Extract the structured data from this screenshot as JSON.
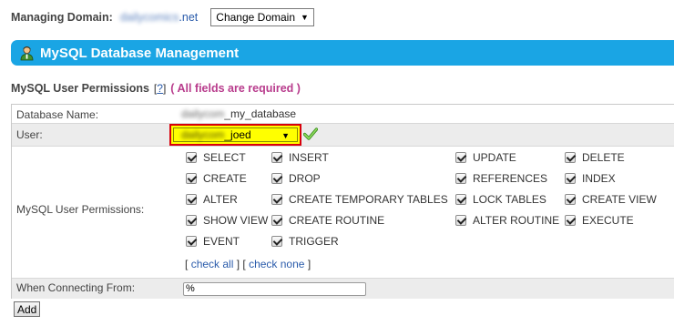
{
  "domain_bar": {
    "label": "Managing Domain:",
    "domain_blurred": "dailycomics",
    "domain_suffix": ".net",
    "change_button": "Change Domain"
  },
  "banner": {
    "title": "MySQL Database Management",
    "icon": "user-icon"
  },
  "section": {
    "title": "MySQL User Permissions",
    "help_open": "[",
    "help_link": "?",
    "help_close": "]",
    "required_note": "( All fields are required )"
  },
  "form": {
    "database_label": "Database Name:",
    "database_prefix_blurred": "dailycom",
    "database_suffix": "_my_database",
    "user_label": "User:",
    "user_prefix_blurred": "dailycom",
    "user_suffix": "_joed",
    "permissions_label": "MySQL User Permissions:",
    "permissions": [
      {
        "label": "SELECT",
        "checked": true
      },
      {
        "label": "INSERT",
        "checked": true
      },
      {
        "label": "UPDATE",
        "checked": true
      },
      {
        "label": "DELETE",
        "checked": true
      },
      {
        "label": "CREATE",
        "checked": true
      },
      {
        "label": "DROP",
        "checked": true
      },
      {
        "label": "REFERENCES",
        "checked": true
      },
      {
        "label": "INDEX",
        "checked": true
      },
      {
        "label": "ALTER",
        "checked": true
      },
      {
        "label": "CREATE TEMPORARY TABLES",
        "checked": true
      },
      {
        "label": "LOCK TABLES",
        "checked": true
      },
      {
        "label": "CREATE VIEW",
        "checked": true
      },
      {
        "label": "SHOW VIEW",
        "checked": true
      },
      {
        "label": "CREATE ROUTINE",
        "checked": true
      },
      {
        "label": "ALTER ROUTINE",
        "checked": true
      },
      {
        "label": "EXECUTE",
        "checked": true
      },
      {
        "label": "EVENT",
        "checked": true
      },
      {
        "label": "TRIGGER",
        "checked": true
      }
    ],
    "check_links": {
      "open": "[",
      "check_all": "check all",
      "sep": "] [",
      "check_none": "check none",
      "close": "]"
    },
    "connecting_label": "When Connecting From:",
    "connecting_value": "%"
  },
  "actions": {
    "add_button": "Add"
  },
  "colors": {
    "banner": "#1aa5e4",
    "required": "#b83b8c",
    "link": "#2b5cab",
    "user_highlight": "#ffff00",
    "user_border": "#d8000c",
    "valid_check": "#6cc04a"
  }
}
